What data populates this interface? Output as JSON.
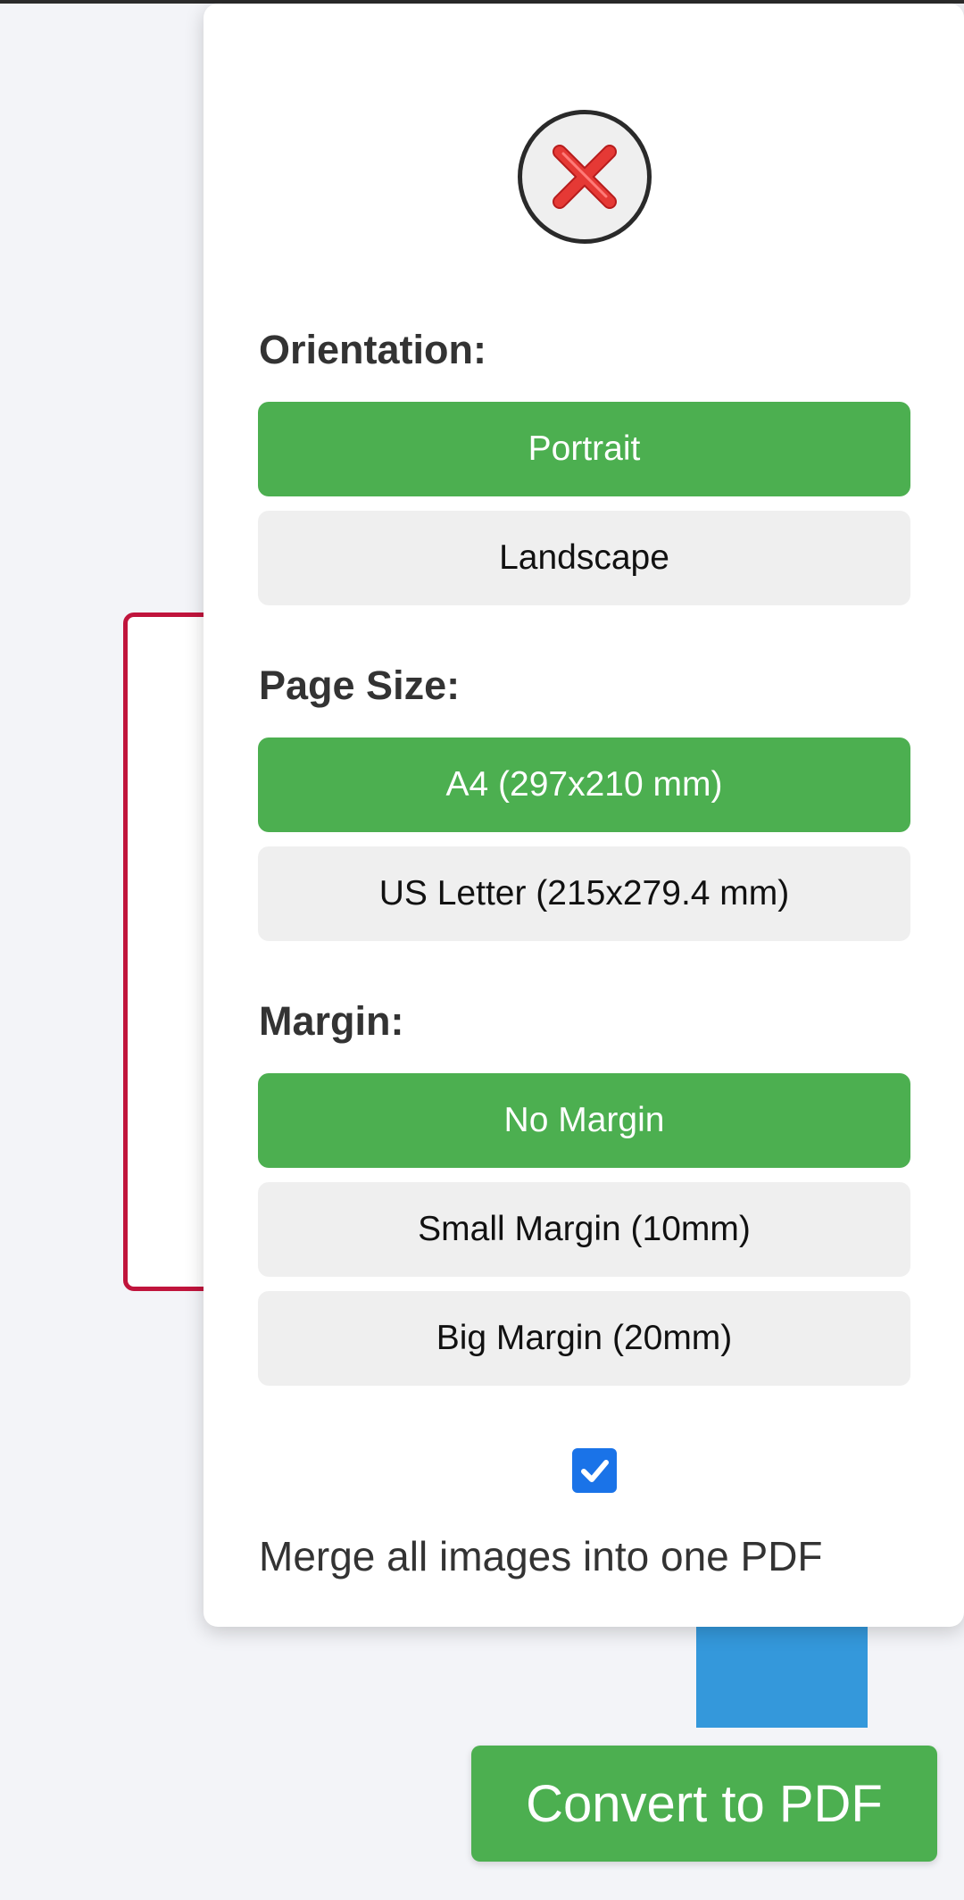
{
  "panel": {
    "close_icon": "close-x-icon",
    "orientation": {
      "label": "Orientation:",
      "options": [
        "Portrait",
        "Landscape"
      ],
      "selected": "Portrait"
    },
    "page_size": {
      "label": "Page Size:",
      "options": [
        "A4 (297x210 mm)",
        "US Letter (215x279.4 mm)"
      ],
      "selected": "A4 (297x210 mm)"
    },
    "margin": {
      "label": "Margin:",
      "options": [
        "No Margin",
        "Small Margin (10mm)",
        "Big Margin (20mm)"
      ],
      "selected": "No Margin"
    },
    "merge": {
      "checked": true,
      "label": "Merge all images into one PDF"
    }
  },
  "footer": {
    "convert_label": "Convert to PDF"
  },
  "colors": {
    "accent": "#4caf50",
    "inactive": "#efefef",
    "checkbox": "#1a73e8",
    "close_x": "#e53935",
    "background_card_border": "#c0143c",
    "background_blue": "#3498db"
  }
}
